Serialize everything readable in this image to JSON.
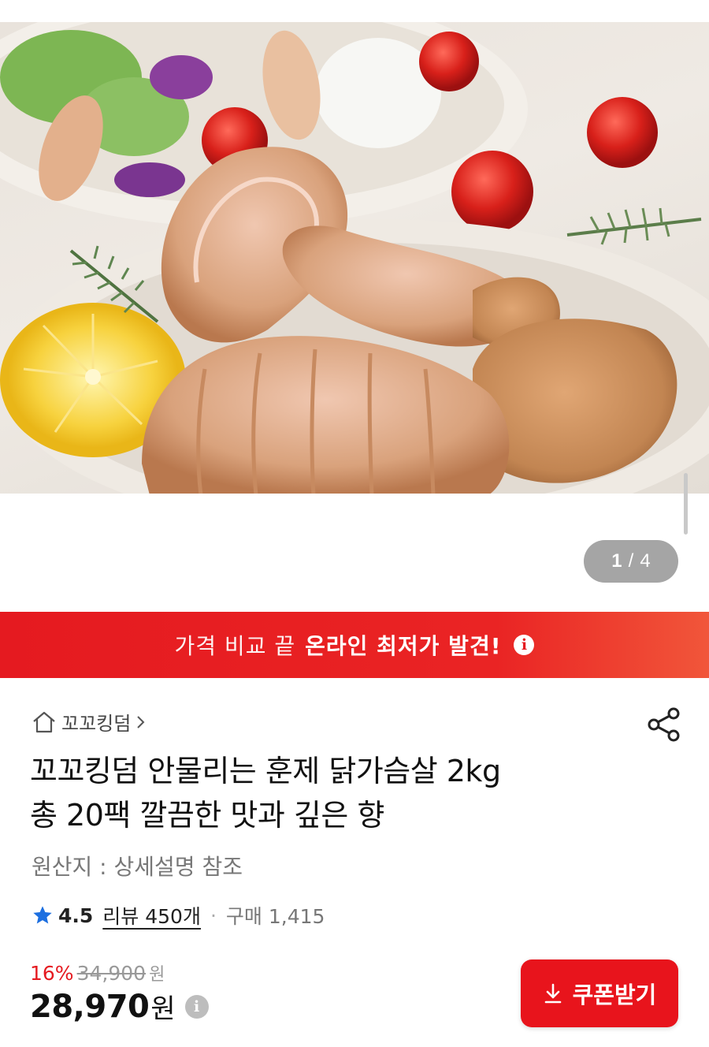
{
  "gallery": {
    "current": "1",
    "separator": "/",
    "total": "4"
  },
  "banner": {
    "plain_text": "가격 비교 끝",
    "strong_text": "온라인 최저가 발견!",
    "info_icon": "info-icon"
  },
  "product": {
    "brand": "꼬꼬킹덤",
    "title_line1": "꼬꼬킹덤 안물리는 훈제 닭가슴살 2kg",
    "title_line2": "총 20팩 깔끔한 맛과 깊은 향",
    "origin": "원산지 : 상세설명 참조",
    "rating": "4.5",
    "reviews": "리뷰 450개",
    "separator": "·",
    "purchases": "구매 1,415",
    "discount_rate": "16%",
    "original_price": "34,900",
    "original_unit": "원",
    "price": "28,970",
    "price_unit": "원"
  },
  "coupon_button": {
    "label": "쿠폰받기"
  },
  "icons": {
    "home": "home-icon",
    "chevron": "chevron-right-icon",
    "share": "share-icon",
    "star": "star-icon",
    "download": "download-icon",
    "price_info": "info-icon"
  },
  "colors": {
    "accent_red": "#e51a20",
    "rating_star": "#1d6fe0",
    "muted_text": "#777777"
  }
}
